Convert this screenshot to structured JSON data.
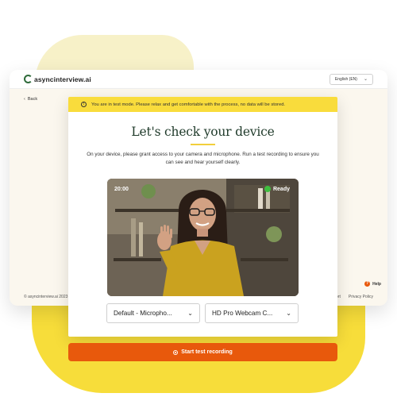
{
  "app": {
    "logo_text": "asyncinterview.ai",
    "language": "English (EN)"
  },
  "nav": {
    "back": "Back"
  },
  "banner": {
    "text": "You are in test mode. Please relax and get comfortable with the process, no data will be stored."
  },
  "main": {
    "title": "Let's check your device",
    "subtitle": "On your device, please grant access to your camera and microphone. Run a test recording to ensure you can see and hear yourself clearly."
  },
  "video": {
    "timer": "20:00",
    "status": "Ready"
  },
  "selects": {
    "microphone": "Default - Micropho...",
    "camera": "HD Pro Webcam C..."
  },
  "actions": {
    "start": "Start test recording"
  },
  "footer": {
    "copyright": "© asyncinterview.ai 2023",
    "support": "port",
    "privacy": "Privacy Policy",
    "help": "Help"
  },
  "colors": {
    "accent": "#e8590c",
    "banner": "#f9dc3c",
    "ready": "#3fbf3f",
    "title": "#1f3a2a"
  }
}
